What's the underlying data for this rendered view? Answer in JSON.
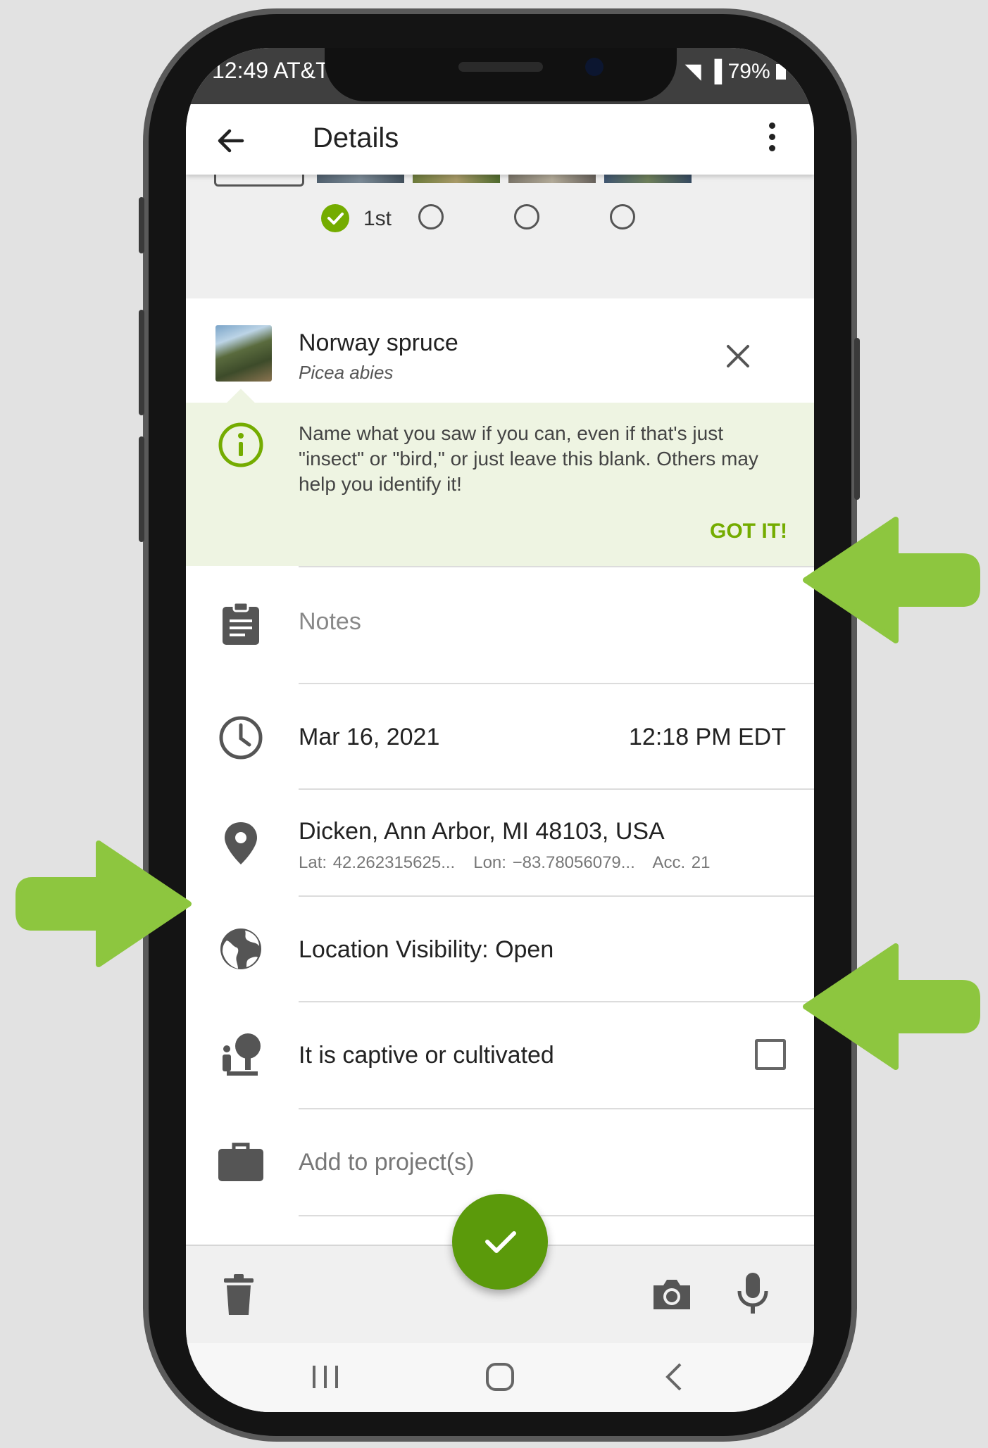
{
  "status": {
    "time": "12:49 AT&T",
    "battery": "79%"
  },
  "header": {
    "title": "Details"
  },
  "photos": {
    "first_label": "1st"
  },
  "taxon": {
    "common_name": "Norway spruce",
    "scientific_name": "Picea abies"
  },
  "tip": {
    "text": "Name what you saw if you can, even if that's just \"insect\" or \"bird,\" or just leave this blank. Others may help you identify it!",
    "action": "GOT IT!"
  },
  "notes": {
    "placeholder": "Notes"
  },
  "datetime": {
    "date": "Mar 16, 2021",
    "time": "12:18 PM EDT"
  },
  "location": {
    "place": "Dicken, Ann Arbor, MI 48103, USA",
    "lat": "Lat: 42.262315625...",
    "lon": "Lon: −83.78056079...",
    "acc": "Acc. 21"
  },
  "visibility": {
    "label": "Location Visibility: Open"
  },
  "captive": {
    "label": "It is captive or cultivated",
    "checked": false
  },
  "projects": {
    "label": "Add to project(s)"
  },
  "colors": {
    "accent": "#74ac00",
    "fab": "#5b9a0b",
    "arrow": "#8dc63f",
    "tip_bg": "#eef4e2"
  }
}
